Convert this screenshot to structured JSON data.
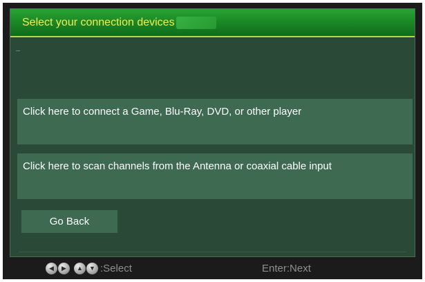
{
  "header": {
    "title": "Select your connection devices"
  },
  "options": [
    {
      "label": "Click here to connect a Game, Blu-Ray, DVD, or other player"
    },
    {
      "label": "Click here to scan channels from the Antenna or coaxial cable input"
    }
  ],
  "back_button": {
    "label": "Go Back"
  },
  "footer": {
    "select_hint": ":Select",
    "enter_hint": "Enter:Next",
    "icons": [
      "left-arrow-icon",
      "right-arrow-icon",
      "up-arrow-icon",
      "down-arrow-icon"
    ]
  },
  "colors": {
    "title_text": "#f2ee52",
    "title_bar": "#1c8a27",
    "panel_background": "#2b4937",
    "option_background": "#3e6a52",
    "footer_text": "#8f8f8f"
  }
}
